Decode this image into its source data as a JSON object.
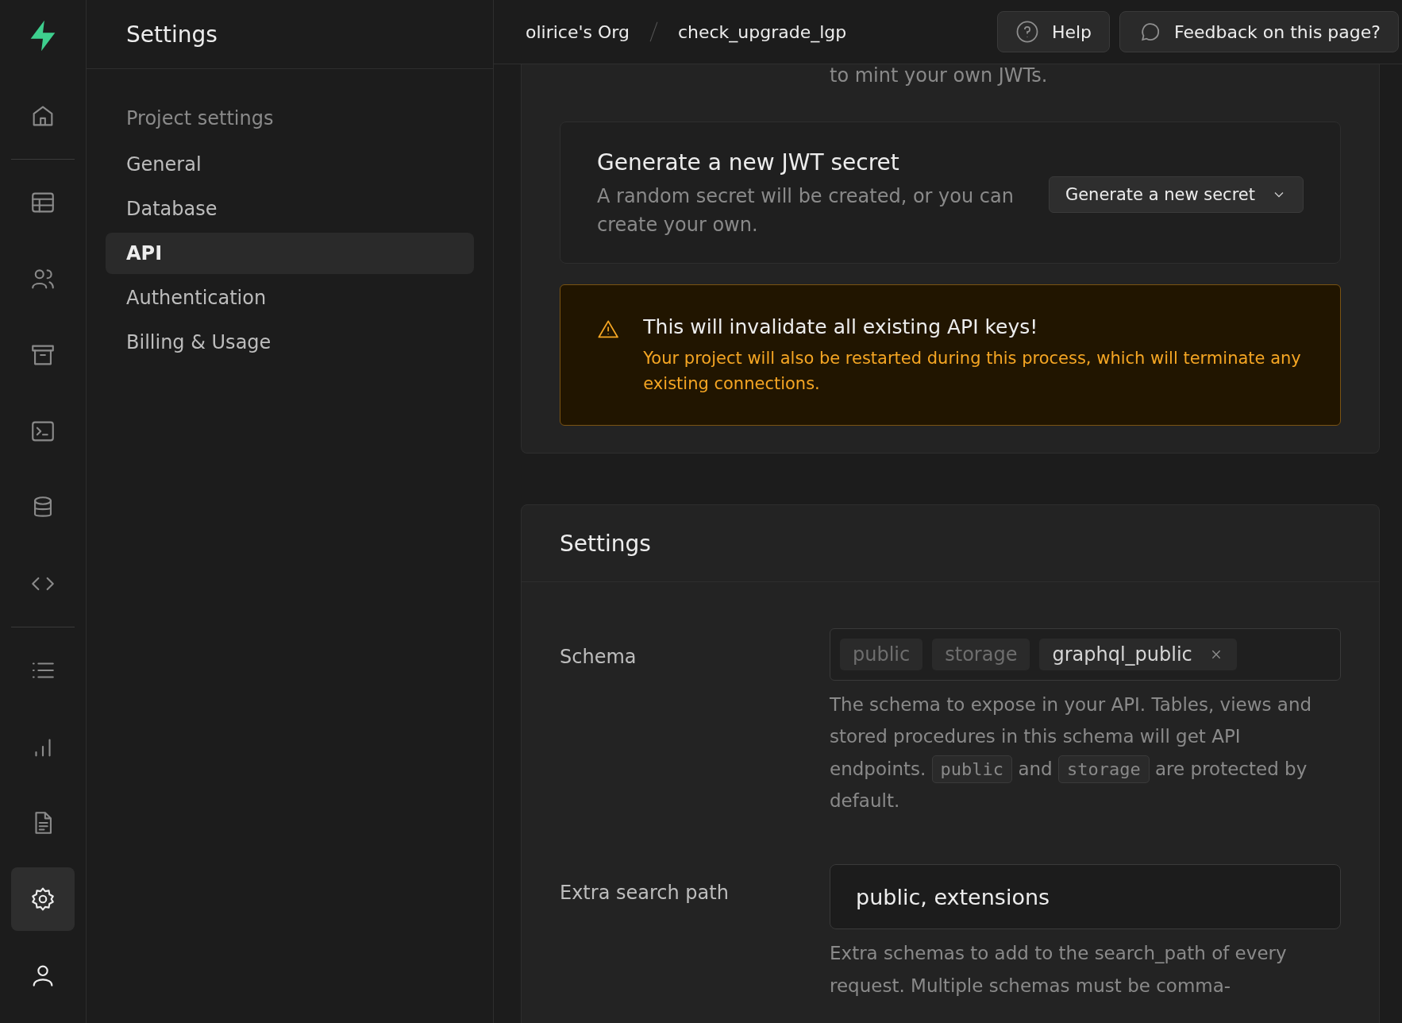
{
  "rail": {
    "items": [
      {
        "selected": false
      },
      {
        "selected": false
      },
      {
        "selected": false
      },
      {
        "selected": false
      },
      {
        "selected": false
      },
      {
        "selected": false
      },
      {
        "selected": false
      },
      {
        "selected": false
      },
      {
        "selected": false
      },
      {
        "selected": false
      },
      {
        "selected": true
      },
      {
        "selected": false
      }
    ]
  },
  "sidebar": {
    "title": "Settings",
    "section": "Project settings",
    "items": [
      {
        "label": "General",
        "selected": false
      },
      {
        "label": "Database",
        "selected": false
      },
      {
        "label": "API",
        "selected": true
      },
      {
        "label": "Authentication",
        "selected": false
      },
      {
        "label": "Billing & Usage",
        "selected": false
      }
    ]
  },
  "breadcrumb": [
    "olirice's Org",
    "check_upgrade_lgp"
  ],
  "header_buttons": [
    {
      "label": "Help"
    },
    {
      "label": "Feedback on this page?"
    }
  ],
  "jwt": {
    "intro": "to mint your own JWTs.",
    "title": "Generate a new JWT secret",
    "description": "A random secret will be created, or you can create your own.",
    "button": "Generate a new secret",
    "warning": {
      "title": "This will invalidate all existing API keys!",
      "text": "Your project will also be restarted during this process, which will terminate any existing connections."
    }
  },
  "settings": {
    "title": "Settings",
    "schema": {
      "label": "Schema",
      "tags": [
        {
          "label": "public",
          "removable": false
        },
        {
          "label": "storage",
          "removable": false
        },
        {
          "label": "graphql_public",
          "removable": true
        }
      ],
      "description": [
        {
          "kind": "text",
          "text": "The schema to expose in your API. Tables, views and stored procedures in this schema will get API endpoints."
        },
        {
          "kind": "code",
          "text": "public"
        },
        {
          "kind": "text",
          "text": "and"
        },
        {
          "kind": "code",
          "text": "storage"
        },
        {
          "kind": "text",
          "text": "are protected by default."
        }
      ]
    },
    "extra_search_path": {
      "label": "Extra search path",
      "value": "public, extensions",
      "description": "Extra schemas to add to the search_path of every request. Multiple schemas must be comma-"
    }
  }
}
